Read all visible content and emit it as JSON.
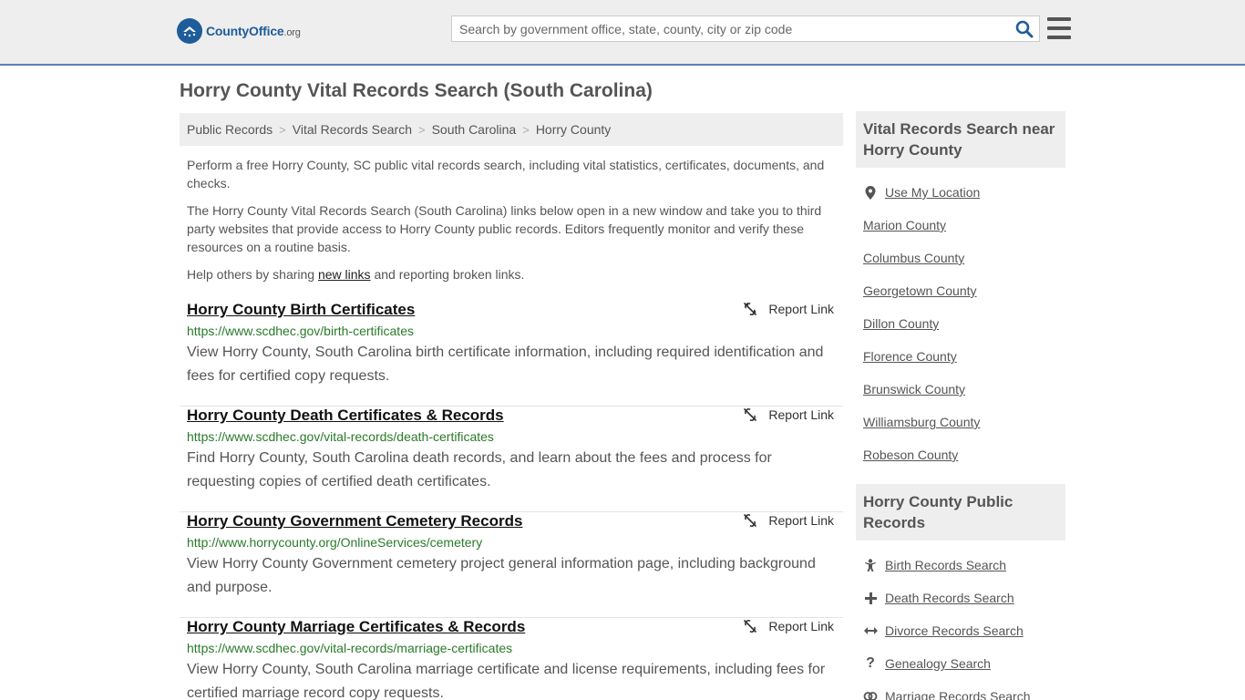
{
  "header": {
    "logo_main": "CountyOffice",
    "logo_tld": ".org",
    "search_placeholder": "Search by government office, state, county, city or zip code"
  },
  "page_title": "Horry County Vital Records Search (South Carolina)",
  "breadcrumb": [
    "Public Records",
    "Vital Records Search",
    "South Carolina",
    "Horry County"
  ],
  "intro": {
    "p1": "Perform a free Horry County, SC public vital records search, including vital statistics, certificates, documents, and checks.",
    "p2": "The Horry County Vital Records Search (South Carolina) links below open in a new window and take you to third party websites that provide access to Horry County public records. Editors frequently monitor and verify these resources on a routine basis.",
    "p3_before": "Help others by sharing ",
    "p3_link": "new links",
    "p3_after": " and reporting broken links."
  },
  "report_label": "Report Link",
  "results": [
    {
      "title": "Horry County Birth Certificates",
      "url": "https://www.scdhec.gov/birth-certificates",
      "desc": "View Horry County, South Carolina birth certificate information, including required identification and fees for certified copy requests."
    },
    {
      "title": "Horry County Death Certificates & Records",
      "url": "https://www.scdhec.gov/vital-records/death-certificates",
      "desc": "Find Horry County, South Carolina death records, and learn about the fees and process for requesting copies of certified death certificates."
    },
    {
      "title": "Horry County Government Cemetery Records",
      "url": "http://www.horrycounty.org/OnlineServices/cemetery",
      "desc": "View Horry County Government cemetery project general information page, including background and purpose."
    },
    {
      "title": "Horry County Marriage Certificates & Records",
      "url": "https://www.scdhec.gov/vital-records/marriage-certificates",
      "desc": "View Horry County, South Carolina marriage certificate and license requirements, including fees for certified marriage record copy requests."
    }
  ],
  "sidebar": {
    "nearby_title": "Vital Records Search near Horry County",
    "use_location": "Use My Location",
    "nearby": [
      "Marion County",
      "Columbus County",
      "Georgetown County",
      "Dillon County",
      "Florence County",
      "Brunswick County",
      "Williamsburg County",
      "Robeson County"
    ],
    "public_title": "Horry County Public Records",
    "public_links": [
      {
        "label": "Birth Records Search",
        "icon": "baby-icon"
      },
      {
        "label": "Death Records Search",
        "icon": "cross-icon"
      },
      {
        "label": "Divorce Records Search",
        "icon": "arrows-horizontal-icon"
      },
      {
        "label": "Genealogy Search",
        "icon": "question-icon"
      },
      {
        "label": "Marriage Records Search",
        "icon": "rings-icon"
      }
    ]
  },
  "colors": {
    "accent": "#1d5d99",
    "url_green": "#2a7a2a",
    "header_bg": "#eeeeee",
    "header_border": "#5b82b3"
  }
}
